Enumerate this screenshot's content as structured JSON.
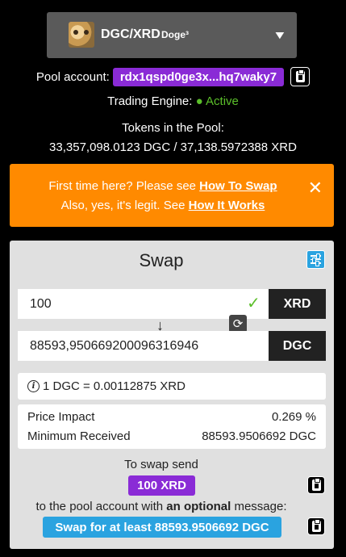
{
  "pair": {
    "name": "DGC/XRD",
    "subtitle": "Doge³",
    "token_image": "doge-token-image",
    "dropdown_icon": "chevron-down-icon"
  },
  "pool": {
    "label": "Pool account:",
    "address": "rdx1qspd0ge3x...hq7waky7",
    "copy_icon": "clipboard-icon"
  },
  "engine": {
    "label": "Trading Engine:",
    "dot": "●",
    "status": "Active"
  },
  "tokens": {
    "label": "Tokens in the Pool:",
    "value": "33,357,098.0123 DGC / 37,138.5972388 XRD"
  },
  "notice": {
    "line1_text": "First time here? Please see ",
    "line1_link": "How To Swap",
    "line2_text": "Also, yes, it's legit. See ",
    "line2_link": "How It Works",
    "close_icon": "close-icon"
  },
  "swap": {
    "title": "Swap",
    "settings_icon": "settings-sliders-icon",
    "from": {
      "value": "100",
      "token": "XRD",
      "valid_icon": "check-icon"
    },
    "direction_arrow": "↓",
    "switch_icon": "swap-refresh-icon",
    "to": {
      "value": "88593,95066920009631694​6",
      "token": "DGC"
    },
    "rate": "1 DGC = 0.00112875 XRD",
    "price_impact_label": "Price Impact",
    "price_impact_value": "0.269 %",
    "min_received_label": "Minimum Received",
    "min_received_value": "88593.9506692 DGC",
    "send_label": "To swap send",
    "send_amount": "100 XRD",
    "message_label_pre": "to the pool account with ",
    "message_label_bold": "an optional",
    "message_label_post": " message:",
    "message": "Swap for at least 88593.9506692 DGC"
  },
  "colors": {
    "accent_purple": "#8a2bd6",
    "notice_orange": "#ff8a00",
    "active_green": "#5bbf2a",
    "accent_blue": "#2aa3e0"
  }
}
